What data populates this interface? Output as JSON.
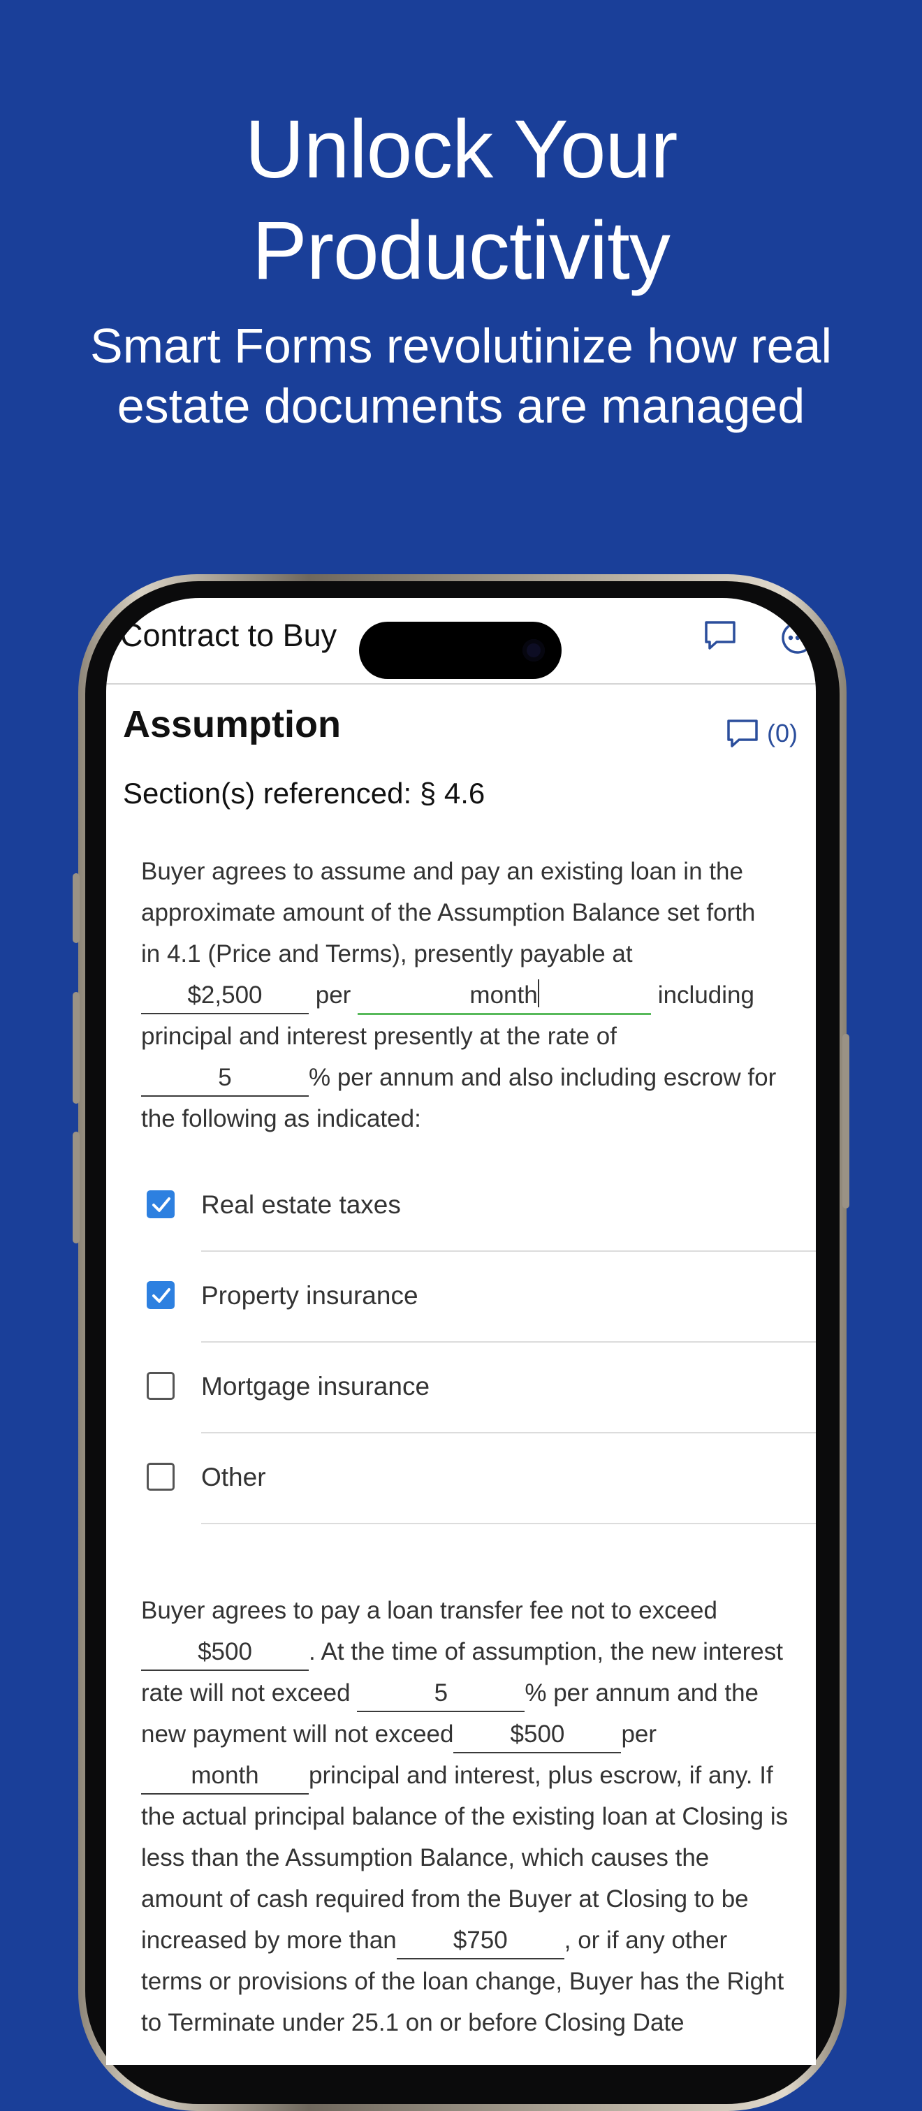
{
  "hero": {
    "title_line1": "Unlock Your",
    "title_line2": "Productivity",
    "subtitle_line1": "Smart Forms revolutinize how real",
    "subtitle_line2": "estate documents are managed"
  },
  "app": {
    "title": "Contract to Buy",
    "section_heading": "Assumption",
    "comment_count": "(0)",
    "sections_referenced": "Section(s) referenced: § 4.6",
    "para1": {
      "line1": "Buyer agrees to assume and pay an existing loan in the",
      "line2": "approximate amount of the Assumption Balance set forth",
      "line3": "in 4.1 (Price and Terms), presently payable at",
      "payment_amount": "$2,500",
      "per": "per",
      "payment_period": "month",
      "including": "including",
      "line5": "principal and interest presently at the rate of",
      "rate": "5",
      "rate_suffix": "% per annum and also including escrow for",
      "line7": "the following as indicated:"
    },
    "escrow_items": [
      {
        "label": "Real estate taxes",
        "checked": true
      },
      {
        "label": "Property insurance",
        "checked": true
      },
      {
        "label": "Mortgage insurance",
        "checked": false
      },
      {
        "label": "Other",
        "checked": false
      }
    ],
    "para2": {
      "line1": "Buyer agrees to pay a loan transfer fee not to exceed",
      "fee": "$500",
      "fee_suffix": ". At the time of assumption, the new interest",
      "rate_prefix": "rate will not exceed",
      "new_rate": "5",
      "rate_suffix": "% per annum and the",
      "payment_prefix": "new payment will not exceed",
      "new_payment": "$500",
      "per": "per",
      "new_period": "month",
      "period_suffix": "principal and interest, plus escrow, if any. If",
      "line6": "the actual principal balance of the existing loan at Closing is",
      "line7": "less than the Assumption Balance, which causes the",
      "line8": "amount of cash required from the Buyer at Closing to be",
      "increase_prefix": "increased by more than",
      "increase_amount": "$750",
      "increase_suffix": ", or if any other",
      "line10": "terms or provisions of the loan change, Buyer has the Right",
      "line11": "to Terminate under 25.1 on or before Closing Date"
    }
  }
}
